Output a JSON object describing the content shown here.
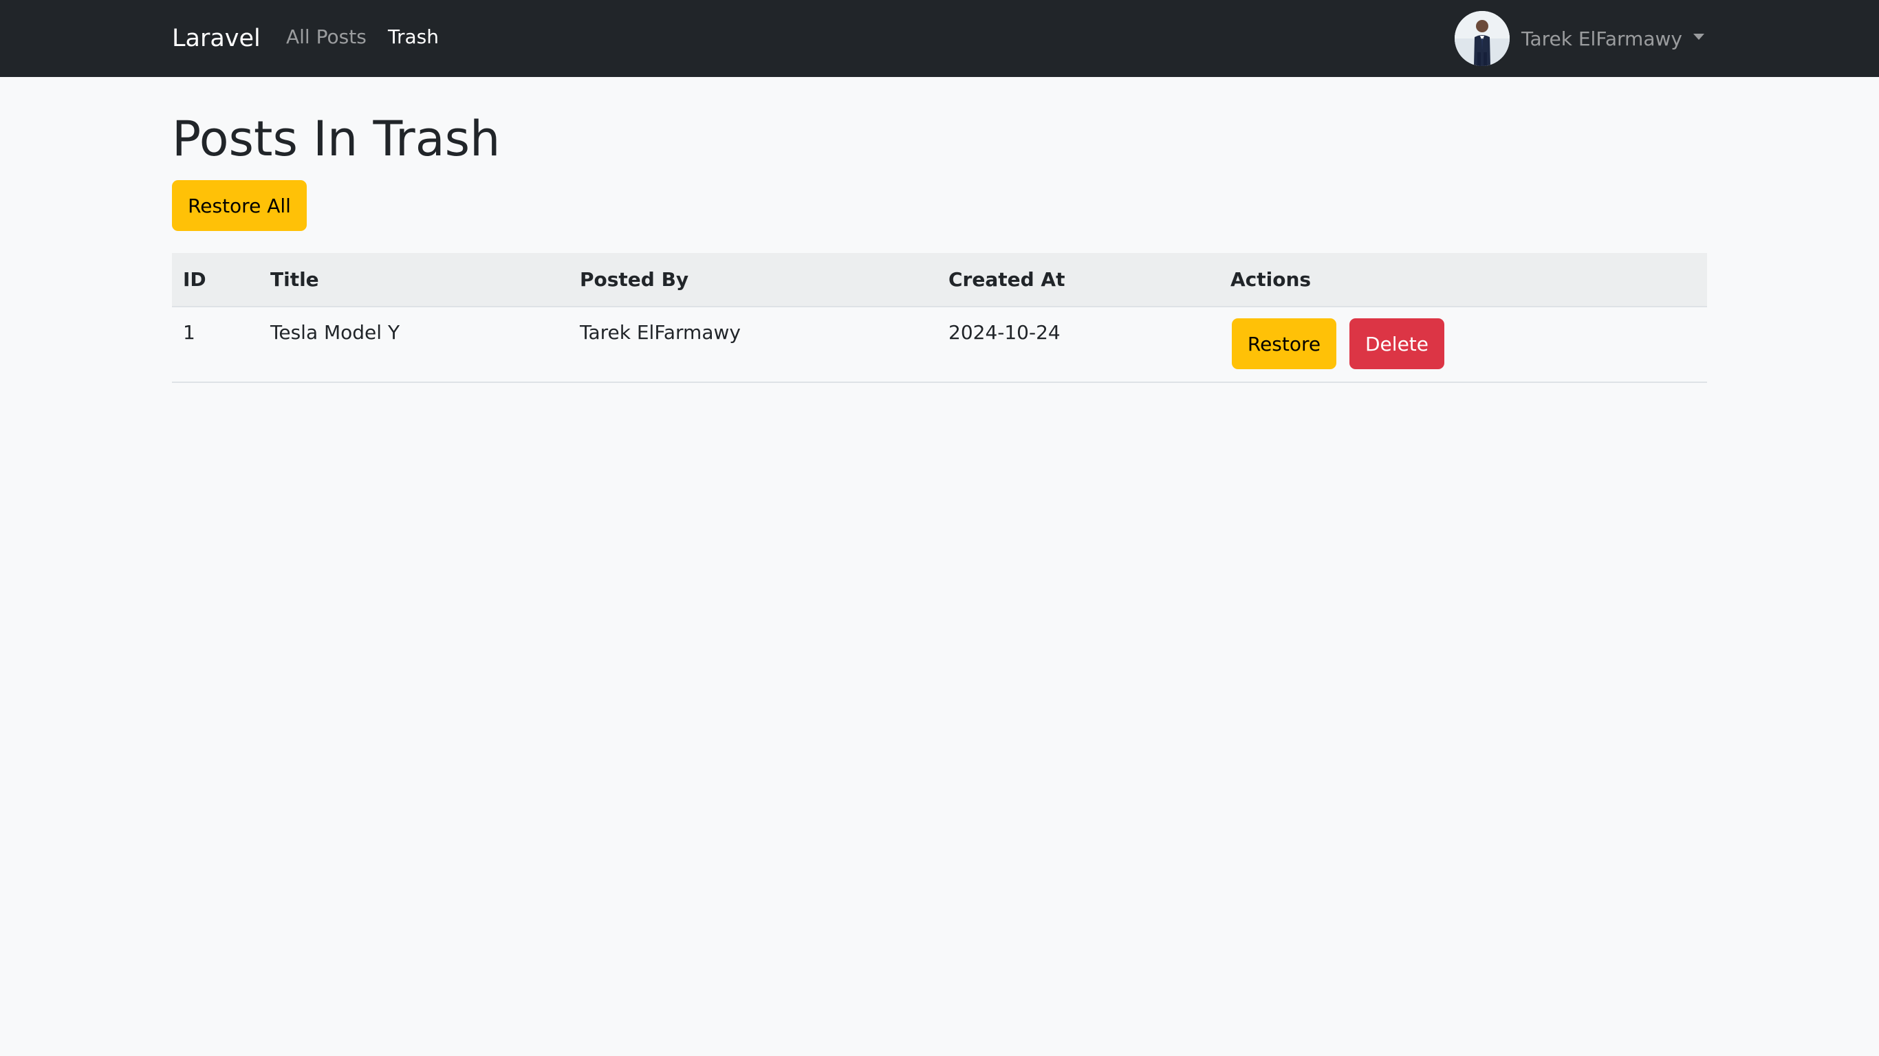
{
  "navbar": {
    "brand": "Laravel",
    "links": [
      {
        "label": "All Posts",
        "active": false
      },
      {
        "label": "Trash",
        "active": true
      }
    ],
    "user": {
      "name": "Tarek ElFarmawy",
      "avatar_icon": "user-avatar-photo",
      "dropdown_icon": "caret-down-icon"
    }
  },
  "page": {
    "title": "Posts In Trash",
    "restore_all_label": "Restore All"
  },
  "table": {
    "headers": [
      "ID",
      "Title",
      "Posted By",
      "Created At",
      "Actions"
    ],
    "rows": [
      {
        "id": "1",
        "title": "Tesla Model Y",
        "posted_by": "Tarek ElFarmawy",
        "created_at": "2024-10-24",
        "actions": {
          "restore_label": "Restore",
          "delete_label": "Delete"
        }
      }
    ]
  },
  "colors": {
    "navbar_bg": "#212529",
    "page_bg": "#f8f9fa",
    "warning": "#ffc107",
    "danger": "#dc3545",
    "table_header_bg": "#eceeef"
  }
}
